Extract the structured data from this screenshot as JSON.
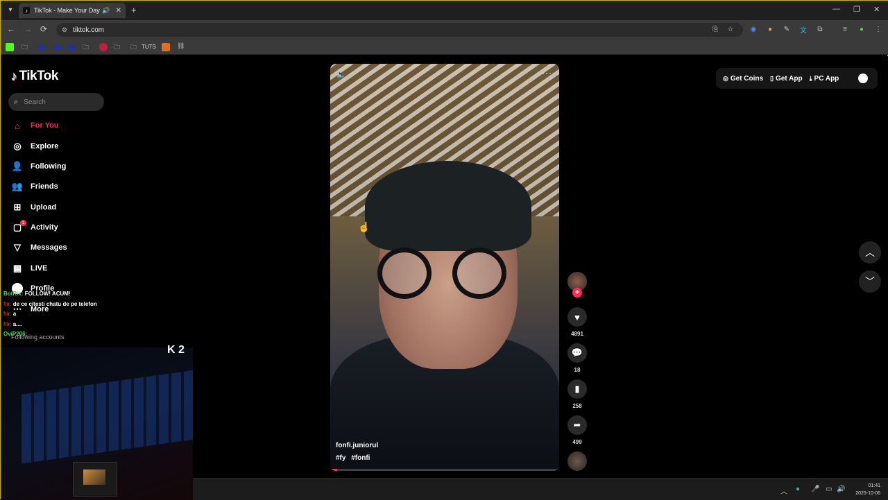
{
  "browser": {
    "tab_title": "TikTok - Make Your Day",
    "url": "tiktok.com",
    "bookmarks_folder_label": "TUTS"
  },
  "tiktok": {
    "logo_text": "TikTok",
    "search_placeholder": "Search",
    "nav": [
      {
        "label": "For You",
        "icon": "home-icon",
        "active": true
      },
      {
        "label": "Explore",
        "icon": "compass-icon"
      },
      {
        "label": "Following",
        "icon": "following-icon"
      },
      {
        "label": "Friends",
        "icon": "friends-icon"
      },
      {
        "label": "Upload",
        "icon": "upload-icon"
      },
      {
        "label": "Activity",
        "icon": "activity-icon",
        "badge": "1"
      },
      {
        "label": "Messages",
        "icon": "messages-icon"
      },
      {
        "label": "LIVE",
        "icon": "live-icon"
      },
      {
        "label": "Profile",
        "icon": "profile-icon"
      },
      {
        "label": "More",
        "icon": "more-icon"
      }
    ],
    "following_accounts_label": "Following accounts",
    "top_actions": {
      "get_coins": "Get Coins",
      "get_app": "Get App",
      "pc_app": "PC App"
    },
    "video": {
      "author": "fonfi.juniorul",
      "hashtags": [
        "#fy",
        "#fonfi"
      ],
      "progress_fraction": 0.03,
      "likes": "4891",
      "comments": "18",
      "saves": "258",
      "shares": "499"
    }
  },
  "stream_overlay": {
    "chat": [
      {
        "user": "BotRix:",
        "message": "FOLLOW! ACUM!"
      },
      {
        "user": "frir:",
        "message": "de ce citesti chatu de pe telefon"
      },
      {
        "user": "frir:",
        "message": "a"
      },
      {
        "user": "frir:",
        "message": "a...."
      },
      {
        "user": "OviP206:",
        "message": ""
      }
    ],
    "k_badge": "2"
  },
  "taskbar": {
    "time": "01:41",
    "date": "2025-10-06"
  },
  "colors": {
    "accent": "#fe2c55",
    "background": "#000000",
    "chrome": "#3a3a3a"
  }
}
